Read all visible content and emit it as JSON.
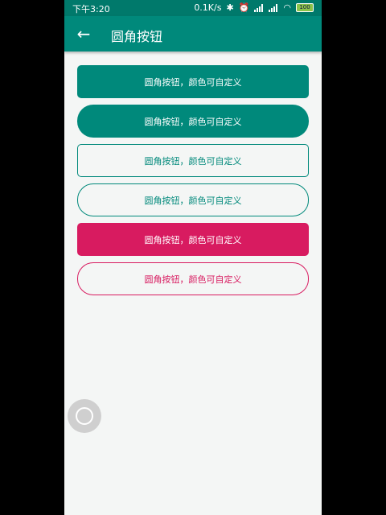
{
  "status": {
    "time": "下午3:20",
    "net_speed": "0.1K/s",
    "battery": "100"
  },
  "toolbar": {
    "title": "圆角按钮"
  },
  "buttons": [
    {
      "label": "圆角按钮，颜色可自定义"
    },
    {
      "label": "圆角按钮，颜色可自定义"
    },
    {
      "label": "圆角按钮，颜色可自定义"
    },
    {
      "label": "圆角按钮，颜色可自定义"
    },
    {
      "label": "圆角按钮，颜色可自定义"
    },
    {
      "label": "圆角按钮，颜色可自定义"
    }
  ],
  "colors": {
    "primary": "#00897b",
    "primary_dark": "#00796b",
    "accent": "#d81b60",
    "background": "#f4f6f5"
  },
  "icons": [
    "back-arrow-icon",
    "bluetooth-icon",
    "alarm-icon",
    "signal-icon",
    "wifi-icon",
    "battery-icon",
    "assistive-touch-icon"
  ]
}
